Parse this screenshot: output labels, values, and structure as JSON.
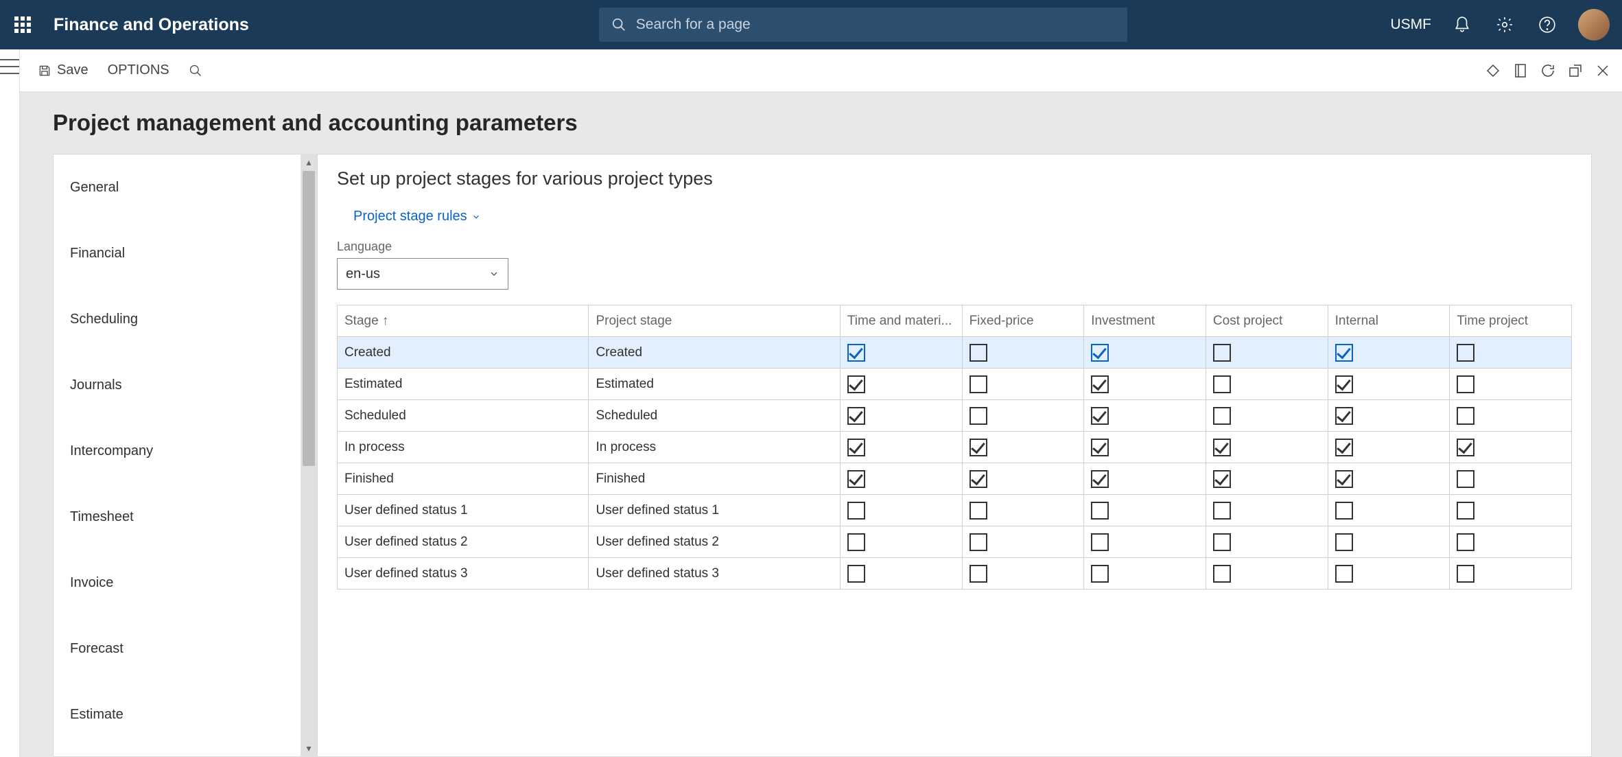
{
  "topnav": {
    "app_name": "Finance and Operations",
    "search_placeholder": "Search for a page",
    "company": "USMF"
  },
  "cmdbar": {
    "save": "Save",
    "options": "OPTIONS"
  },
  "page": {
    "title": "Project management and accounting parameters"
  },
  "sidelist": {
    "items": [
      "General",
      "Financial",
      "Scheduling",
      "Journals",
      "Intercompany",
      "Timesheet",
      "Invoice",
      "Forecast",
      "Estimate"
    ]
  },
  "form": {
    "heading": "Set up project stages for various project types",
    "rules_link": "Project stage rules",
    "language_label": "Language",
    "language_value": "en-us"
  },
  "grid": {
    "columns": [
      "Stage",
      "Project stage",
      "Time and materi...",
      "Fixed-price",
      "Investment",
      "Cost project",
      "Internal",
      "Time project"
    ],
    "rows": [
      {
        "stage": "Created",
        "project_stage": "Created",
        "c": [
          true,
          false,
          true,
          false,
          true,
          false
        ],
        "selected": true
      },
      {
        "stage": "Estimated",
        "project_stage": "Estimated",
        "c": [
          true,
          false,
          true,
          false,
          true,
          false
        ],
        "selected": false
      },
      {
        "stage": "Scheduled",
        "project_stage": "Scheduled",
        "c": [
          true,
          false,
          true,
          false,
          true,
          false
        ],
        "selected": false
      },
      {
        "stage": "In process",
        "project_stage": "In process",
        "c": [
          true,
          true,
          true,
          true,
          true,
          true
        ],
        "selected": false
      },
      {
        "stage": "Finished",
        "project_stage": "Finished",
        "c": [
          true,
          true,
          true,
          true,
          true,
          false
        ],
        "selected": false
      },
      {
        "stage": "User defined status 1",
        "project_stage": "User defined status 1",
        "c": [
          false,
          false,
          false,
          false,
          false,
          false
        ],
        "selected": false
      },
      {
        "stage": "User defined status 2",
        "project_stage": "User defined status 2",
        "c": [
          false,
          false,
          false,
          false,
          false,
          false
        ],
        "selected": false
      },
      {
        "stage": "User defined status 3",
        "project_stage": "User defined status 3",
        "c": [
          false,
          false,
          false,
          false,
          false,
          false
        ],
        "selected": false
      }
    ]
  }
}
